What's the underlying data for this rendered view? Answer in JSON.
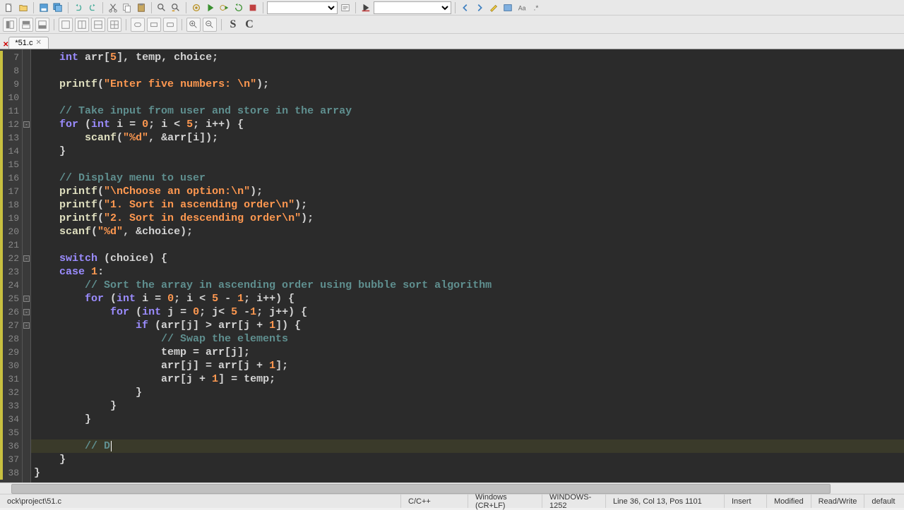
{
  "tab": {
    "name": "*51.c"
  },
  "toolbar2_letters": {
    "s": "S",
    "c": "C"
  },
  "gutter_start": 7,
  "gutter_end": 38,
  "fold_marks": {
    "12": true,
    "22": true,
    "25": true,
    "26": true,
    "27": true
  },
  "changed_lines": [
    7,
    8,
    9,
    10,
    11,
    12,
    13,
    14,
    15,
    16,
    17,
    18,
    19,
    20,
    21,
    22,
    23,
    24,
    25,
    26,
    27,
    28,
    29,
    30,
    31,
    32,
    33,
    34,
    35,
    36,
    37,
    38
  ],
  "highlight_line": 36,
  "code": {
    "7": {
      "indent": 1,
      "tokens": [
        {
          "t": "kw",
          "v": "int"
        },
        {
          "t": "txt",
          "v": " arr["
        },
        {
          "t": "num",
          "v": "5"
        },
        {
          "t": "txt",
          "v": "], temp, choice;"
        }
      ]
    },
    "8": {
      "indent": 1,
      "tokens": []
    },
    "9": {
      "indent": 1,
      "tokens": [
        {
          "t": "fn",
          "v": "printf"
        },
        {
          "t": "txt",
          "v": "("
        },
        {
          "t": "str",
          "v": "\"Enter five numbers: \\n\""
        },
        {
          "t": "txt",
          "v": ");"
        }
      ]
    },
    "10": {
      "indent": 1,
      "tokens": []
    },
    "11": {
      "indent": 1,
      "tokens": [
        {
          "t": "cmt",
          "v": "// Take input from user and store in the array"
        }
      ]
    },
    "12": {
      "indent": 1,
      "tokens": [
        {
          "t": "kw",
          "v": "for"
        },
        {
          "t": "txt",
          "v": " ("
        },
        {
          "t": "kw",
          "v": "int"
        },
        {
          "t": "txt",
          "v": " i = "
        },
        {
          "t": "num",
          "v": "0"
        },
        {
          "t": "txt",
          "v": "; i < "
        },
        {
          "t": "num",
          "v": "5"
        },
        {
          "t": "txt",
          "v": "; i++) {"
        }
      ]
    },
    "13": {
      "indent": 2,
      "tokens": [
        {
          "t": "fn",
          "v": "scanf"
        },
        {
          "t": "txt",
          "v": "("
        },
        {
          "t": "str",
          "v": "\"%d\""
        },
        {
          "t": "txt",
          "v": ", &arr[i]);"
        }
      ]
    },
    "14": {
      "indent": 1,
      "tokens": [
        {
          "t": "txt",
          "v": "}"
        }
      ]
    },
    "15": {
      "indent": 1,
      "tokens": []
    },
    "16": {
      "indent": 1,
      "tokens": [
        {
          "t": "cmt",
          "v": "// Display menu to user"
        }
      ]
    },
    "17": {
      "indent": 1,
      "tokens": [
        {
          "t": "fn",
          "v": "printf"
        },
        {
          "t": "txt",
          "v": "("
        },
        {
          "t": "str",
          "v": "\"\\nChoose an option:\\n\""
        },
        {
          "t": "txt",
          "v": ");"
        }
      ]
    },
    "18": {
      "indent": 1,
      "tokens": [
        {
          "t": "fn",
          "v": "printf"
        },
        {
          "t": "txt",
          "v": "("
        },
        {
          "t": "str",
          "v": "\"1. Sort in ascending order\\n\""
        },
        {
          "t": "txt",
          "v": ");"
        }
      ]
    },
    "19": {
      "indent": 1,
      "tokens": [
        {
          "t": "fn",
          "v": "printf"
        },
        {
          "t": "txt",
          "v": "("
        },
        {
          "t": "str",
          "v": "\"2. Sort in descending order\\n\""
        },
        {
          "t": "txt",
          "v": ");"
        }
      ]
    },
    "20": {
      "indent": 1,
      "tokens": [
        {
          "t": "fn",
          "v": "scanf"
        },
        {
          "t": "txt",
          "v": "("
        },
        {
          "t": "str",
          "v": "\"%d\""
        },
        {
          "t": "txt",
          "v": ", &choice);"
        }
      ]
    },
    "21": {
      "indent": 1,
      "tokens": []
    },
    "22": {
      "indent": 1,
      "tokens": [
        {
          "t": "kw",
          "v": "switch"
        },
        {
          "t": "txt",
          "v": " (choice) {"
        }
      ]
    },
    "23": {
      "indent": 1,
      "tokens": [
        {
          "t": "kw",
          "v": "case"
        },
        {
          "t": "txt",
          "v": " "
        },
        {
          "t": "num",
          "v": "1"
        },
        {
          "t": "txt",
          "v": ":"
        }
      ]
    },
    "24": {
      "indent": 2,
      "tokens": [
        {
          "t": "cmt",
          "v": "// Sort the array in ascending order using bubble sort algorithm"
        }
      ]
    },
    "25": {
      "indent": 2,
      "tokens": [
        {
          "t": "kw",
          "v": "for"
        },
        {
          "t": "txt",
          "v": " ("
        },
        {
          "t": "kw",
          "v": "int"
        },
        {
          "t": "txt",
          "v": " i = "
        },
        {
          "t": "num",
          "v": "0"
        },
        {
          "t": "txt",
          "v": "; i < "
        },
        {
          "t": "num",
          "v": "5"
        },
        {
          "t": "txt",
          "v": " - "
        },
        {
          "t": "num",
          "v": "1"
        },
        {
          "t": "txt",
          "v": "; i++) {"
        }
      ]
    },
    "26": {
      "indent": 3,
      "tokens": [
        {
          "t": "kw",
          "v": "for"
        },
        {
          "t": "txt",
          "v": " ("
        },
        {
          "t": "kw",
          "v": "int"
        },
        {
          "t": "txt",
          "v": " j = "
        },
        {
          "t": "num",
          "v": "0"
        },
        {
          "t": "txt",
          "v": "; j< "
        },
        {
          "t": "num",
          "v": "5"
        },
        {
          "t": "txt",
          "v": " -"
        },
        {
          "t": "num",
          "v": "1"
        },
        {
          "t": "txt",
          "v": "; j++) {"
        }
      ]
    },
    "27": {
      "indent": 4,
      "tokens": [
        {
          "t": "kw",
          "v": "if"
        },
        {
          "t": "txt",
          "v": " (arr[j] > arr[j + "
        },
        {
          "t": "num",
          "v": "1"
        },
        {
          "t": "txt",
          "v": "]) {"
        }
      ]
    },
    "28": {
      "indent": 5,
      "tokens": [
        {
          "t": "cmt",
          "v": "// Swap the elements"
        }
      ]
    },
    "29": {
      "indent": 5,
      "tokens": [
        {
          "t": "txt",
          "v": "temp = arr[j];"
        }
      ]
    },
    "30": {
      "indent": 5,
      "tokens": [
        {
          "t": "txt",
          "v": "arr[j] = arr[j + "
        },
        {
          "t": "num",
          "v": "1"
        },
        {
          "t": "txt",
          "v": "];"
        }
      ]
    },
    "31": {
      "indent": 5,
      "tokens": [
        {
          "t": "txt",
          "v": "arr[j + "
        },
        {
          "t": "num",
          "v": "1"
        },
        {
          "t": "txt",
          "v": "] = temp;"
        }
      ]
    },
    "32": {
      "indent": 4,
      "tokens": [
        {
          "t": "txt",
          "v": "}"
        }
      ]
    },
    "33": {
      "indent": 3,
      "tokens": [
        {
          "t": "txt",
          "v": "}"
        }
      ]
    },
    "34": {
      "indent": 2,
      "tokens": [
        {
          "t": "txt",
          "v": "}"
        }
      ]
    },
    "35": {
      "indent": 2,
      "tokens": []
    },
    "36": {
      "indent": 2,
      "tokens": [
        {
          "t": "cmt",
          "v": "// D"
        }
      ],
      "cursor": true
    },
    "37": {
      "indent": 1,
      "tokens": [
        {
          "t": "txt",
          "v": "}"
        }
      ]
    },
    "38": {
      "indent": 0,
      "tokens": [
        {
          "t": "txt",
          "v": "}"
        }
      ]
    }
  },
  "statusbar": {
    "path": "ock\\project\\51.c",
    "lang": "C/C++",
    "eol": "Windows (CR+LF)",
    "encoding": "WINDOWS-1252",
    "position": "Line 36, Col 13, Pos 1101",
    "insert": "Insert",
    "modified": "Modified",
    "readwrite": "Read/Write",
    "default": "default"
  }
}
